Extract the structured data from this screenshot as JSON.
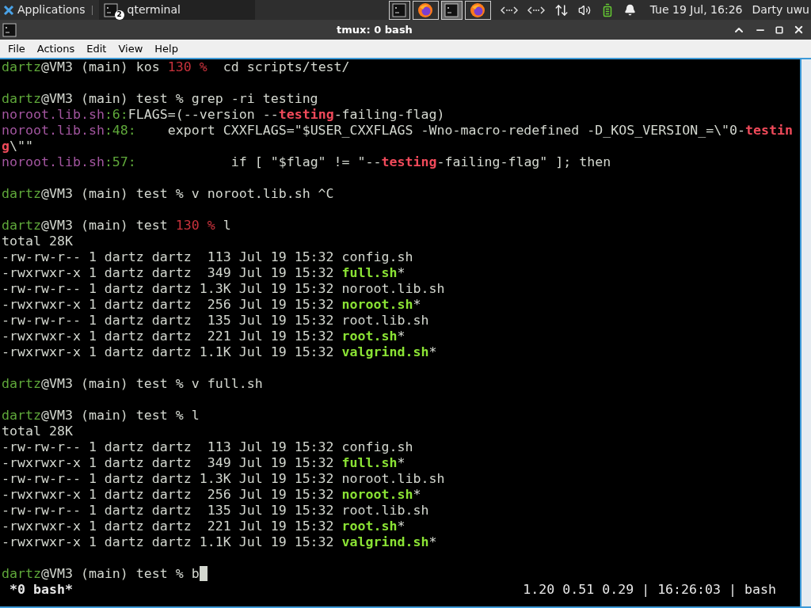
{
  "panel": {
    "menu_label": "Applications",
    "task": {
      "label": "qterminal",
      "badge": "2"
    },
    "tray_tasks": [
      {
        "kind": "terminal",
        "selected": false
      },
      {
        "kind": "browser",
        "selected": false
      },
      {
        "kind": "terminal",
        "selected": true
      },
      {
        "kind": "browser",
        "selected": false
      }
    ],
    "clock": "Tue 19 Jul, 16:26",
    "user": "Darty uwu"
  },
  "window": {
    "title": "tmux: 0 bash"
  },
  "menu": [
    "File",
    "Actions",
    "Edit",
    "View",
    "Help"
  ],
  "terminal": {
    "lines": [
      {
        "kind": "text",
        "segments": [
          {
            "text": "dartz",
            "kind": "user"
          },
          {
            "text": "@VM3 (main) kos ",
            "kind": "plain"
          },
          {
            "text": "130 %",
            "kind": "error"
          },
          {
            "text": "  cd scripts/test/",
            "kind": "plain"
          }
        ]
      },
      {
        "kind": "blank"
      },
      {
        "kind": "text",
        "segments": [
          {
            "text": "dartz",
            "kind": "user"
          },
          {
            "text": "@VM3 (main) test % grep -ri testing",
            "kind": "plain"
          }
        ]
      },
      {
        "kind": "text",
        "segments": [
          {
            "text": "noroot.lib.sh",
            "kind": "file"
          },
          {
            "text": ":6:",
            "kind": "lineno"
          },
          {
            "text": "FLAGS=(--version --",
            "kind": "plain"
          },
          {
            "text": "testing",
            "kind": "match"
          },
          {
            "text": "-failing-flag)",
            "kind": "plain"
          }
        ]
      },
      {
        "kind": "text",
        "segments": [
          {
            "text": "noroot.lib.sh",
            "kind": "file"
          },
          {
            "text": ":48:",
            "kind": "lineno"
          },
          {
            "text": "    export CXXFLAGS=\"$USER_CXXFLAGS -Wno-macro-redefined -D_KOS_VERSION_=\\\"0-",
            "kind": "plain"
          },
          {
            "text": "testin",
            "kind": "match"
          }
        ]
      },
      {
        "kind": "text",
        "segments": [
          {
            "text": "g",
            "kind": "match"
          },
          {
            "text": "\\\"\"",
            "kind": "plain"
          }
        ]
      },
      {
        "kind": "text",
        "segments": [
          {
            "text": "noroot.lib.sh",
            "kind": "file"
          },
          {
            "text": ":57:",
            "kind": "lineno"
          },
          {
            "text": "            if [ \"$flag\" != \"--",
            "kind": "plain"
          },
          {
            "text": "testing",
            "kind": "match"
          },
          {
            "text": "-failing-flag\" ]; then",
            "kind": "plain"
          }
        ]
      },
      {
        "kind": "blank"
      },
      {
        "kind": "text",
        "segments": [
          {
            "text": "dartz",
            "kind": "user"
          },
          {
            "text": "@VM3 (main) test % v noroot.lib.sh ^C",
            "kind": "plain"
          }
        ]
      },
      {
        "kind": "blank"
      },
      {
        "kind": "text",
        "segments": [
          {
            "text": "dartz",
            "kind": "user"
          },
          {
            "text": "@VM3 (main) test ",
            "kind": "plain"
          },
          {
            "text": "130 %",
            "kind": "error"
          },
          {
            "text": " l",
            "kind": "plain"
          }
        ]
      },
      {
        "kind": "text",
        "segments": [
          {
            "text": "total 28K",
            "kind": "plain"
          }
        ]
      },
      {
        "kind": "text",
        "segments": [
          {
            "text": "-rw-rw-r-- 1 dartz dartz  113 Jul 19 15:32 config.sh",
            "kind": "plain"
          }
        ]
      },
      {
        "kind": "text",
        "segments": [
          {
            "text": "-rwxrwxr-x 1 dartz dartz  349 Jul 19 15:32 ",
            "kind": "plain"
          },
          {
            "text": "full.sh",
            "kind": "exec"
          },
          {
            "text": "*",
            "kind": "plain"
          }
        ]
      },
      {
        "kind": "text",
        "segments": [
          {
            "text": "-rw-rw-r-- 1 dartz dartz 1.3K Jul 19 15:32 noroot.lib.sh",
            "kind": "plain"
          }
        ]
      },
      {
        "kind": "text",
        "segments": [
          {
            "text": "-rwxrwxr-x 1 dartz dartz  256 Jul 19 15:32 ",
            "kind": "plain"
          },
          {
            "text": "noroot.sh",
            "kind": "exec"
          },
          {
            "text": "*",
            "kind": "plain"
          }
        ]
      },
      {
        "kind": "text",
        "segments": [
          {
            "text": "-rw-rw-r-- 1 dartz dartz  135 Jul 19 15:32 root.lib.sh",
            "kind": "plain"
          }
        ]
      },
      {
        "kind": "text",
        "segments": [
          {
            "text": "-rwxrwxr-x 1 dartz dartz  221 Jul 19 15:32 ",
            "kind": "plain"
          },
          {
            "text": "root.sh",
            "kind": "exec"
          },
          {
            "text": "*",
            "kind": "plain"
          }
        ]
      },
      {
        "kind": "text",
        "segments": [
          {
            "text": "-rwxrwxr-x 1 dartz dartz 1.1K Jul 19 15:32 ",
            "kind": "plain"
          },
          {
            "text": "valgrind.sh",
            "kind": "exec"
          },
          {
            "text": "*",
            "kind": "plain"
          }
        ]
      },
      {
        "kind": "blank"
      },
      {
        "kind": "text",
        "segments": [
          {
            "text": "dartz",
            "kind": "user"
          },
          {
            "text": "@VM3 (main) test % v full.sh",
            "kind": "plain"
          }
        ]
      },
      {
        "kind": "blank"
      },
      {
        "kind": "text",
        "segments": [
          {
            "text": "dartz",
            "kind": "user"
          },
          {
            "text": "@VM3 (main) test % l",
            "kind": "plain"
          }
        ]
      },
      {
        "kind": "text",
        "segments": [
          {
            "text": "total 28K",
            "kind": "plain"
          }
        ]
      },
      {
        "kind": "text",
        "segments": [
          {
            "text": "-rw-rw-r-- 1 dartz dartz  113 Jul 19 15:32 config.sh",
            "kind": "plain"
          }
        ]
      },
      {
        "kind": "text",
        "segments": [
          {
            "text": "-rwxrwxr-x 1 dartz dartz  349 Jul 19 15:32 ",
            "kind": "plain"
          },
          {
            "text": "full.sh",
            "kind": "exec"
          },
          {
            "text": "*",
            "kind": "plain"
          }
        ]
      },
      {
        "kind": "text",
        "segments": [
          {
            "text": "-rw-rw-r-- 1 dartz dartz 1.3K Jul 19 15:32 noroot.lib.sh",
            "kind": "plain"
          }
        ]
      },
      {
        "kind": "text",
        "segments": [
          {
            "text": "-rwxrwxr-x 1 dartz dartz  256 Jul 19 15:32 ",
            "kind": "plain"
          },
          {
            "text": "noroot.sh",
            "kind": "exec"
          },
          {
            "text": "*",
            "kind": "plain"
          }
        ]
      },
      {
        "kind": "text",
        "segments": [
          {
            "text": "-rw-rw-r-- 1 dartz dartz  135 Jul 19 15:32 root.lib.sh",
            "kind": "plain"
          }
        ]
      },
      {
        "kind": "text",
        "segments": [
          {
            "text": "-rwxrwxr-x 1 dartz dartz  221 Jul 19 15:32 ",
            "kind": "plain"
          },
          {
            "text": "root.sh",
            "kind": "exec"
          },
          {
            "text": "*",
            "kind": "plain"
          }
        ]
      },
      {
        "kind": "text",
        "segments": [
          {
            "text": "-rwxrwxr-x 1 dartz dartz 1.1K Jul 19 15:32 ",
            "kind": "plain"
          },
          {
            "text": "valgrind.sh",
            "kind": "exec"
          },
          {
            "text": "*",
            "kind": "plain"
          }
        ]
      },
      {
        "kind": "blank"
      },
      {
        "kind": "text",
        "cursor": true,
        "segments": [
          {
            "text": "dartz",
            "kind": "user"
          },
          {
            "text": "@VM3 (main) test % b",
            "kind": "plain"
          }
        ]
      }
    ],
    "status": {
      "left": "*0 bash*",
      "right": "1.20 0.51 0.29 | 16:26:03 | bash"
    }
  }
}
